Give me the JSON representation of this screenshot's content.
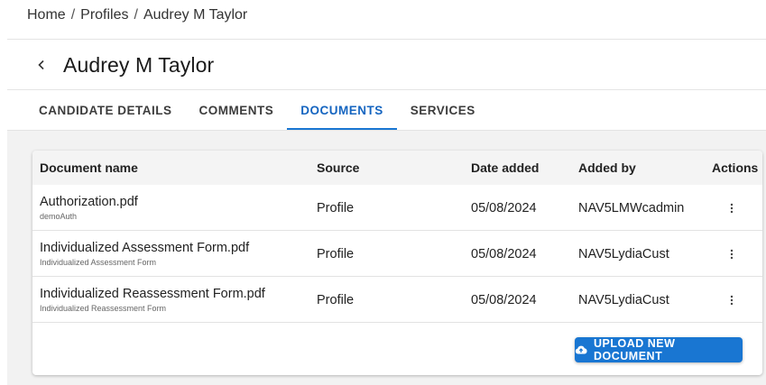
{
  "breadcrumb": {
    "items": [
      "Home",
      "Profiles",
      "Audrey M Taylor"
    ],
    "separator": "/"
  },
  "header": {
    "title": "Audrey M Taylor",
    "back_icon": "chevron-left-icon"
  },
  "tabs": [
    {
      "label": "CANDIDATE DETAILS",
      "active": false
    },
    {
      "label": "COMMENTS",
      "active": false
    },
    {
      "label": "DOCUMENTS",
      "active": true
    },
    {
      "label": "SERVICES",
      "active": false
    }
  ],
  "table": {
    "columns": [
      "Document name",
      "Source",
      "Date added",
      "Added by",
      "Actions"
    ],
    "rows": [
      {
        "name": "Authorization.pdf",
        "description": "demoAuth",
        "source": "Profile",
        "date": "05/08/2024",
        "added_by": "NAV5LMWcadmin",
        "action_icon": "more-vert-icon"
      },
      {
        "name": "Individualized Assessment Form.pdf",
        "description": "Individualized Assessment Form",
        "source": "Profile",
        "date": "05/08/2024",
        "added_by": "NAV5LydiaCust",
        "action_icon": "more-vert-icon"
      },
      {
        "name": "Individualized Reassessment Form.pdf",
        "description": "Individualized Reassessment Form",
        "source": "Profile",
        "date": "05/08/2024",
        "added_by": "NAV5LydiaCust",
        "action_icon": "more-vert-icon"
      }
    ]
  },
  "upload_button": {
    "label": "UPLOAD NEW DOCUMENT",
    "icon": "cloud-upload-icon"
  },
  "colors": {
    "accent": "#1976d2",
    "active_tab": "#1565c0",
    "content_background": "#f2f2f2"
  }
}
